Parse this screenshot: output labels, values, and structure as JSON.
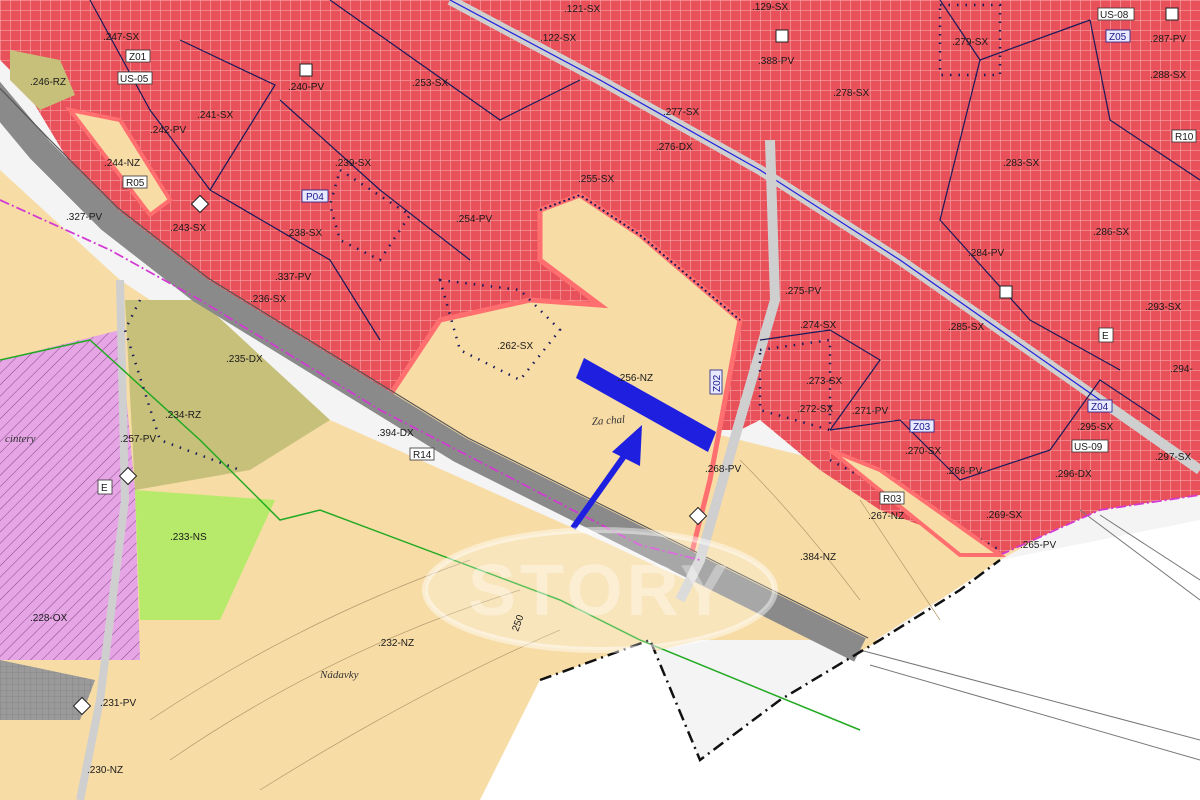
{
  "colors": {
    "residential": "#e8505a",
    "residential_line": "#c23a44",
    "parcel_highlight": "#ff8080",
    "planned_area": "#f7dca6",
    "road": "#8a8a8a",
    "olive": "#c7c07a",
    "green": "#b7ea6a",
    "violet": "#e6a6e6",
    "white_area": "#f4f4f4",
    "marker": "#1f1fe0",
    "boundary": "#1a1a5a",
    "magenta": "#d33ad3"
  },
  "labels": {
    "p247": ".247-SX",
    "p121": ".121-SX",
    "p129": ".129-SX",
    "p279": ".279-SX",
    "p287": ".287-PV",
    "p388": ".388-PV",
    "p253": ".253-SX",
    "p240": ".240-PV",
    "p122": ".122-SX",
    "p246": ".246-RZ",
    "p241": ".241-SX",
    "p242": ".242-PV",
    "p277": ".277-SX",
    "p278": ".278-SX",
    "p288": ".288-SX",
    "p276": ".276-DX",
    "p239": ".239-SX",
    "p244": ".244-NZ",
    "p255": ".255-SX",
    "p283": ".283-SX",
    "p327": ".327-PV",
    "p243": ".243-SX",
    "p238": ".238-SX",
    "p254": ".254-PV",
    "p286": ".286-SX",
    "p284": ".284-PV",
    "p337": ".337-PV",
    "p236": ".236-SX",
    "p275": ".275-PV",
    "p293": ".293-SX",
    "p274": ".274-SX",
    "p285": ".285-SX",
    "p262": ".262-SX",
    "p235": ".235-DX",
    "p256": ".256-NZ",
    "p273": ".273-SX",
    "p294": ".294-",
    "p234": ".234-RZ",
    "p272": ".272-SX",
    "p271": ".271-PV",
    "p394": ".394-DX",
    "p270": ".270-SX",
    "p295": ".295-SX",
    "p257": ".257-PV",
    "p297": ".297-SX",
    "p296": ".296-DX",
    "p266": ".266-PV",
    "p268": ".268-PV",
    "p267": ".267-NZ",
    "p269": ".269-SX",
    "p233": ".233-NS",
    "p384": ".384-NZ",
    "p265": ".265-PV",
    "p228": ".228-OX",
    "p232": ".232-NZ",
    "p231": ".231-PV",
    "p230": ".230-NZ"
  },
  "tags": {
    "z01": "Z01",
    "us05": "US-05",
    "r05": "R05",
    "p04": "P04",
    "z02": "Z02",
    "r14": "R14",
    "z03": "Z03",
    "r03": "R03",
    "z04": "Z04",
    "us09": "US-09",
    "us08": "US-08",
    "z05": "Z05",
    "r10": "R10",
    "e1": "E",
    "e2": "E"
  },
  "place_names": {
    "za_chaloupky": "Za chal",
    "nadavky": "Nádavky",
    "cintery": "cintery"
  },
  "contour": "250",
  "watermark": "STORY"
}
